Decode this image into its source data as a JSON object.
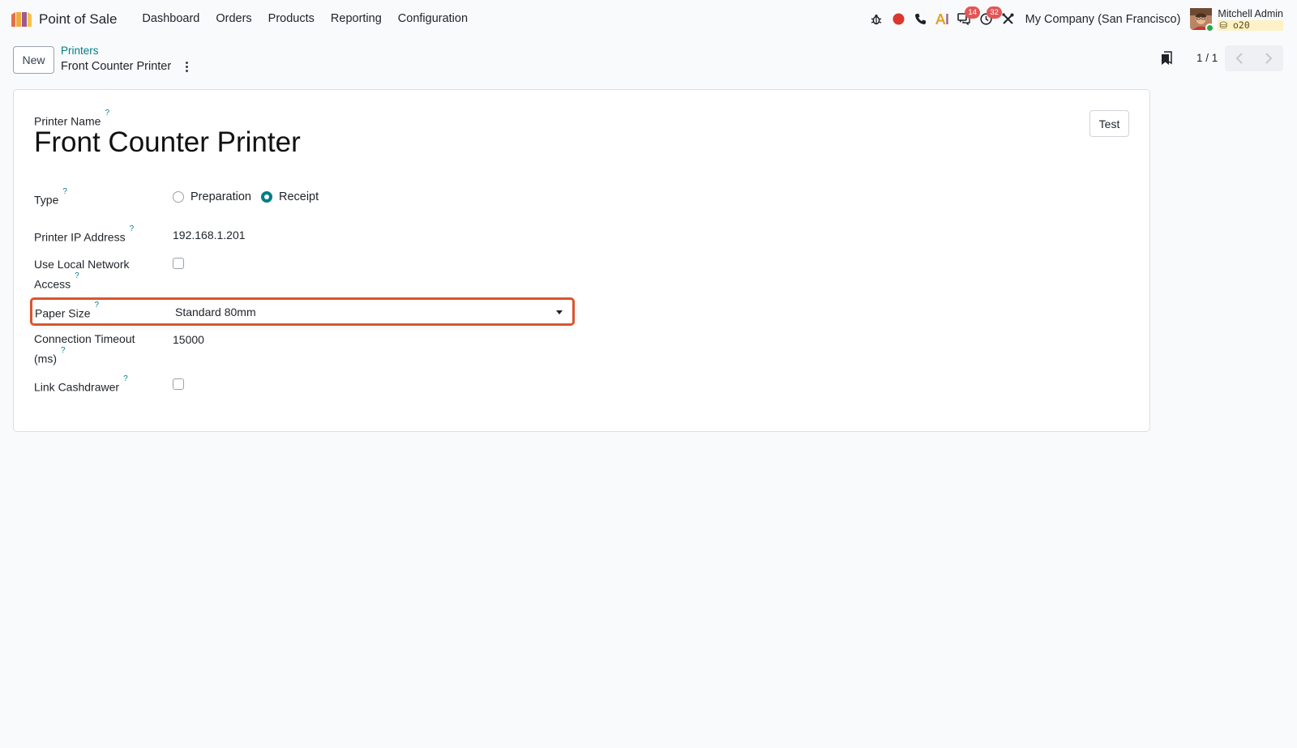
{
  "app": {
    "name": "Point of Sale"
  },
  "menu": {
    "items": [
      {
        "label": "Dashboard"
      },
      {
        "label": "Orders"
      },
      {
        "label": "Products"
      },
      {
        "label": "Reporting"
      },
      {
        "label": "Configuration"
      }
    ]
  },
  "systray": {
    "messages_count": "14",
    "activities_count": "32",
    "company": "My Company (San Francisco)",
    "user_name": "Mitchell Admin",
    "db_name": "o20",
    "icons": [
      "debug-icon",
      "record-icon",
      "phone-icon",
      "ai-icon",
      "messages-icon",
      "activity-clock-icon",
      "tools-icon"
    ]
  },
  "control_panel": {
    "new_label": "New",
    "breadcrumb_parent": "Printers",
    "breadcrumb_current": "Front Counter Printer",
    "pager_value": "1 / 1"
  },
  "form": {
    "test_label": "Test",
    "name_label": "Printer Name",
    "name_value": "Front Counter Printer",
    "help_mark": "?",
    "type": {
      "label": "Type",
      "options": [
        {
          "label": "Preparation",
          "checked": false
        },
        {
          "label": "Receipt",
          "checked": true
        }
      ]
    },
    "ip": {
      "label": "Printer IP Address",
      "value": "192.168.1.201"
    },
    "local_network": {
      "label_line1": "Use Local Network",
      "label_line2": "Access",
      "checked": false
    },
    "paper_size": {
      "label": "Paper Size",
      "value": "Standard 80mm"
    },
    "timeout": {
      "label_line1": "Connection Timeout",
      "label_line2": "(ms)",
      "value": "15000"
    },
    "cashdrawer": {
      "label": "Link Cashdrawer",
      "checked": false
    }
  },
  "colors": {
    "accent": "#017e84",
    "highlight_border": "#d9562e",
    "badge": "#e45656",
    "record": "#d9382f"
  }
}
